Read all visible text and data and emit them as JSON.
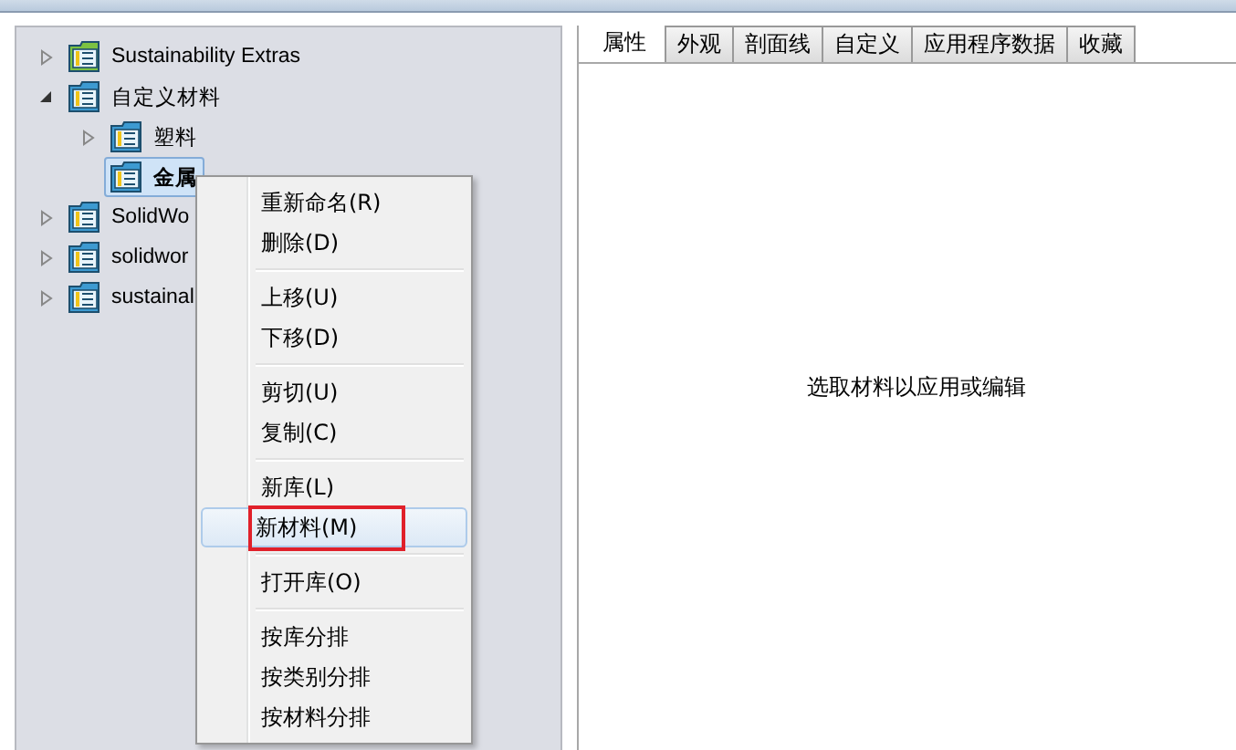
{
  "tree": [
    {
      "label": "Sustainability Extras",
      "color": "#7cc242",
      "expanded": false,
      "selected": false
    },
    {
      "label": "自定义材料",
      "color": "#3d9ad1",
      "expanded": true,
      "selected": false,
      "children": [
        {
          "label": "塑料",
          "color": "#3d9ad1",
          "expanded": false,
          "selected": false
        },
        {
          "label": "金属",
          "color": "#3d9ad1",
          "selected": true
        }
      ]
    },
    {
      "label": "SolidWo",
      "color": "#3d9ad1",
      "expanded": false,
      "selected": false
    },
    {
      "label": "solidwor",
      "color": "#3d9ad1",
      "expanded": false,
      "selected": false
    },
    {
      "label": "sustainal",
      "color": "#3d9ad1",
      "expanded": false,
      "selected": false
    }
  ],
  "context_menu": {
    "groups": [
      [
        {
          "label": "重新命名(R)",
          "selected": false,
          "marked": false
        },
        {
          "label": "删除(D)",
          "selected": false,
          "marked": false
        }
      ],
      [
        {
          "label": "上移(U)",
          "selected": false,
          "marked": false
        },
        {
          "label": "下移(D)",
          "selected": false,
          "marked": false
        }
      ],
      [
        {
          "label": "剪切(U)",
          "selected": false,
          "marked": false
        },
        {
          "label": "复制(C)",
          "selected": false,
          "marked": false
        }
      ],
      [
        {
          "label": "新库(L)",
          "selected": false,
          "marked": false
        },
        {
          "label": "新材料(M)",
          "selected": true,
          "marked": true
        }
      ],
      [
        {
          "label": "打开库(O)",
          "selected": false,
          "marked": false
        }
      ],
      [
        {
          "label": "按库分排",
          "selected": false,
          "marked": false
        },
        {
          "label": "按类别分排",
          "selected": false,
          "marked": false
        },
        {
          "label": "按材料分排",
          "selected": false,
          "marked": false
        }
      ]
    ]
  },
  "tabs": [
    {
      "label": "属性",
      "selected": true
    },
    {
      "label": "外观",
      "selected": false
    },
    {
      "label": "剖面线",
      "selected": false
    },
    {
      "label": "自定义",
      "selected": false
    },
    {
      "label": "应用程序数据",
      "selected": false
    },
    {
      "label": "收藏",
      "selected": false
    }
  ],
  "hint": "选取材料以应用或编辑"
}
